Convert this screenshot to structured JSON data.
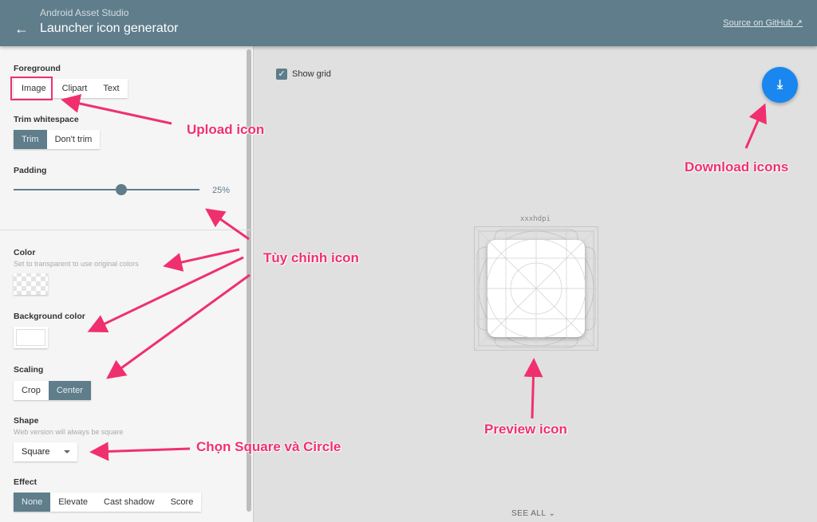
{
  "header": {
    "subtitle": "Android Asset Studio",
    "title": "Launcher icon generator",
    "source_link": "Source on GitHub",
    "back_icon": "arrow-left-icon"
  },
  "sidebar": {
    "foreground": {
      "label": "Foreground",
      "options": [
        "Image",
        "Clipart",
        "Text"
      ],
      "selected": "Image"
    },
    "trim": {
      "label": "Trim whitespace",
      "options": [
        "Trim",
        "Don't trim"
      ],
      "selected": "Trim"
    },
    "padding": {
      "label": "Padding",
      "value": "25%",
      "percent": 25
    },
    "color": {
      "label": "Color",
      "hint": "Set to transparent to use original colors"
    },
    "background_color": {
      "label": "Background color",
      "value": "#ffffff"
    },
    "scaling": {
      "label": "Scaling",
      "options": [
        "Crop",
        "Center"
      ],
      "selected": "Center"
    },
    "shape": {
      "label": "Shape",
      "hint": "Web version will always be square",
      "value": "Square"
    },
    "effect": {
      "label": "Effect",
      "options": [
        "None",
        "Elevate",
        "Cast shadow",
        "Score"
      ],
      "selected": "None"
    }
  },
  "main": {
    "show_grid": {
      "label": "Show grid",
      "checked": true
    },
    "density": "xxxhdpi",
    "see_all": "SEE ALL",
    "download_icon": "download-icon"
  },
  "annotations": {
    "upload": "Upload icon",
    "download": "Download icons",
    "customize": "Tùy chỉnh icon",
    "preview": "Preview icon",
    "shape": "Chọn Square và Circle"
  },
  "colors": {
    "header": "#5f7d8b",
    "accent": "#5f7d8b",
    "fab": "#1a86f0",
    "annotation": "#f0306e"
  }
}
